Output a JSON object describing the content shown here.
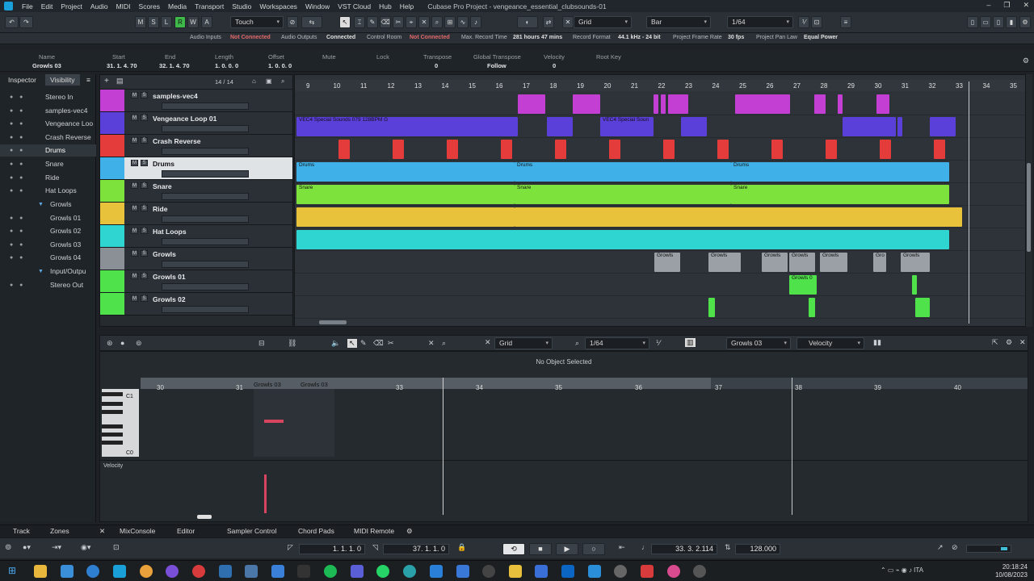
{
  "window": {
    "title": "Cubase Pro Project - vengeance_essential_clubsounds-01",
    "menu": [
      "File",
      "Edit",
      "Project",
      "Audio",
      "MIDI",
      "Scores",
      "Media",
      "Transport",
      "Studio",
      "Workspaces",
      "Window",
      "VST Cloud",
      "Hub",
      "Help"
    ]
  },
  "toolbar": {
    "mode_buttons": [
      "M",
      "S",
      "L",
      "R",
      "W",
      "A"
    ],
    "automation_mode": "Touch",
    "snap_type": "Grid",
    "grid_value": "Bar",
    "quantize": "1/64"
  },
  "status_line": {
    "audio_inputs_label": "Audio Inputs",
    "audio_inputs_value": "Not Connected",
    "audio_outputs_label": "Audio Outputs",
    "audio_outputs_value": "Connected",
    "control_room_label": "Control Room",
    "control_room_value": "Not Connected",
    "max_record_label": "Max. Record Time",
    "max_record_value": "281 hours 47 mins",
    "record_format_label": "Record Format",
    "record_format_value": "44.1 kHz - 24 bit",
    "frame_rate_label": "Project Frame Rate",
    "frame_rate_value": "30 fps",
    "pan_law_label": "Project Pan Law",
    "pan_law_value": "Equal Power"
  },
  "info_line": {
    "headers": [
      "Name",
      "Start",
      "End",
      "Length",
      "Offset",
      "Mute",
      "Lock",
      "Transpose",
      "Global Transpose",
      "Velocity",
      "Root Key"
    ],
    "values": [
      "Growls 03",
      "31. 1. 4. 70",
      "32. 1. 4. 70",
      "1. 0. 0. 0",
      "1. 0. 0. 0",
      "",
      "",
      "0",
      "Follow",
      "0",
      ""
    ]
  },
  "inspector": {
    "tab_inspector": "Inspector",
    "tab_visibility": "Visibility",
    "items": [
      "Stereo In",
      "samples-vec4",
      "Vengeance Loo",
      "Crash Reverse",
      "Drums",
      "Snare",
      "Ride",
      "Hat Loops",
      "Growls",
      "Growls 01",
      "Growls 02",
      "Growls 03",
      "Growls 04",
      "Input/Outpu",
      "Stereo Out"
    ]
  },
  "tracklist": {
    "count": "14 / 14",
    "tracks": [
      {
        "name": "samples-vec4",
        "color": "#c33fd4"
      },
      {
        "name": "Vengeance Loop 01",
        "color": "#5b3fd9"
      },
      {
        "name": "Crash Reverse",
        "color": "#e43b3b"
      },
      {
        "name": "Drums",
        "color": "#3fb1e8"
      },
      {
        "name": "Snare",
        "color": "#7ee23d"
      },
      {
        "name": "Ride",
        "color": "#e7c23a"
      },
      {
        "name": "Hat Loops",
        "color": "#2ed5d1"
      },
      {
        "name": "Growls",
        "color": "#8a9096"
      },
      {
        "name": "Growls 01",
        "color": "#4fe24a"
      },
      {
        "name": "Growls 02",
        "color": "#4fe24a"
      }
    ]
  },
  "ruler": [
    "9",
    "10",
    "11",
    "12",
    "13",
    "14",
    "15",
    "16",
    "17",
    "18",
    "19",
    "20",
    "21",
    "22",
    "23",
    "24",
    "25",
    "26",
    "27",
    "28",
    "29",
    "30",
    "31",
    "32",
    "33",
    "34",
    "35"
  ],
  "events": {
    "vengeance_a": "VEC4 Special Sounds 079 128BPM G",
    "vengeance_b": "VEC4 Special Soun",
    "drums": "Drums",
    "snare": "Snare",
    "growls": "Growls",
    "growls_short": "Gro",
    "growls_0": "Growls 0"
  },
  "editor": {
    "snap_type": "Grid",
    "quantize": "1/64",
    "part_name": "Growls 03",
    "lane": "Velocity",
    "no_object": "No Object Selected",
    "ruler": [
      "30",
      "31",
      "33",
      "34",
      "35",
      "36",
      "37",
      "38",
      "39",
      "40"
    ],
    "part_label_1": "Growls 03",
    "part_label_2": "Growls 03",
    "key_c1": "C1",
    "key_c0": "C0",
    "velocity_label": "Velocity"
  },
  "bottom_tabs": [
    "Track",
    "Zones",
    "MixConsole",
    "Editor",
    "Sampler Control",
    "Chord Pads",
    "MIDI Remote"
  ],
  "transport": {
    "left_locator": "1. 1. 1.   0",
    "right_locator": "37. 1. 1.   0",
    "position": "33. 3. 2.114",
    "tempo": "128.000"
  },
  "taskbar": {
    "time": "20:18:24",
    "date": "10/08/2023"
  }
}
